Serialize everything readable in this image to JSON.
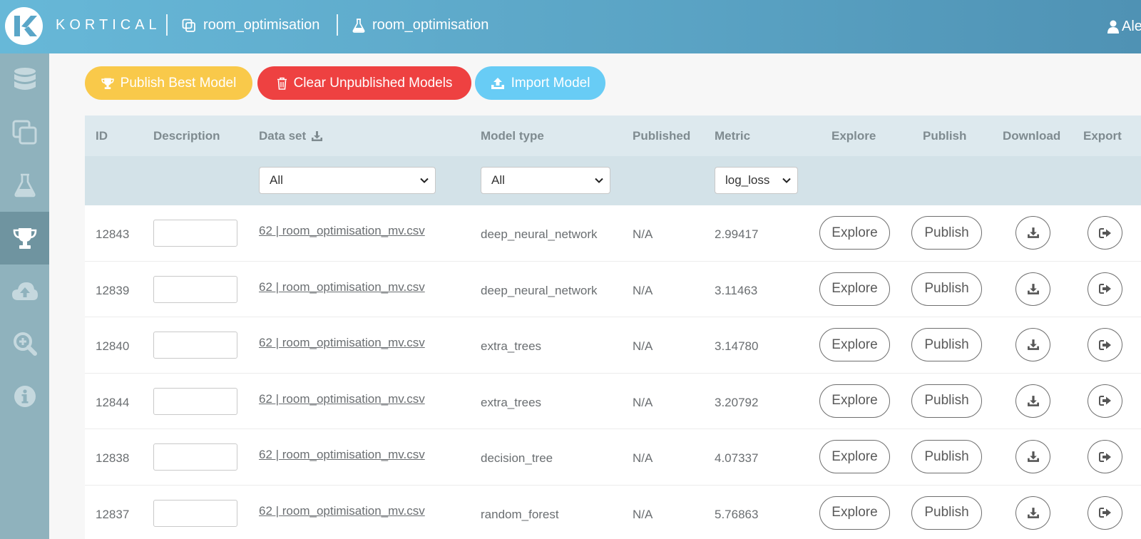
{
  "header": {
    "brand": "KORTICAL",
    "project": "room_optimisation",
    "experiment": "room_optimisation",
    "user": "Ale"
  },
  "sidebar": {
    "items": [
      {
        "name": "database-icon",
        "active": false
      },
      {
        "name": "copy-icon",
        "active": false
      },
      {
        "name": "flask-icon",
        "active": false
      },
      {
        "name": "trophy-icon",
        "active": true
      },
      {
        "name": "cloud-upload-icon",
        "active": false
      },
      {
        "name": "search-plus-icon",
        "active": false
      },
      {
        "name": "info-icon",
        "active": false
      }
    ]
  },
  "actions": {
    "publish_best": "Publish Best Model",
    "clear_unpublished": "Clear Unpublished Models",
    "import_model": "Import Model"
  },
  "colors": {
    "publish_best": "#f9c94a",
    "clear_unpublished": "#ee4141",
    "import_model": "#68ccf5"
  },
  "table": {
    "headers": {
      "id": "ID",
      "description": "Description",
      "dataset": "Data set",
      "model_type": "Model type",
      "published": "Published",
      "metric": "Metric",
      "explore": "Explore",
      "publish": "Publish",
      "download": "Download",
      "export": "Export"
    },
    "filters": {
      "dataset": "All",
      "model_type": "All",
      "metric": "log_loss"
    },
    "explore_label": "Explore",
    "publish_label": "Publish",
    "rows": [
      {
        "id": "12843",
        "description": "",
        "dataset": "62 | room_optimisation_mv.csv",
        "model_type": "deep_neural_network",
        "published": "N/A",
        "metric": "2.99417"
      },
      {
        "id": "12839",
        "description": "",
        "dataset": "62 | room_optimisation_mv.csv",
        "model_type": "deep_neural_network",
        "published": "N/A",
        "metric": "3.11463"
      },
      {
        "id": "12840",
        "description": "",
        "dataset": "62 | room_optimisation_mv.csv",
        "model_type": "extra_trees",
        "published": "N/A",
        "metric": "3.14780"
      },
      {
        "id": "12844",
        "description": "",
        "dataset": "62 | room_optimisation_mv.csv",
        "model_type": "extra_trees",
        "published": "N/A",
        "metric": "3.20792"
      },
      {
        "id": "12838",
        "description": "",
        "dataset": "62 | room_optimisation_mv.csv",
        "model_type": "decision_tree",
        "published": "N/A",
        "metric": "4.07337"
      },
      {
        "id": "12837",
        "description": "",
        "dataset": "62 | room_optimisation_mv.csv",
        "model_type": "random_forest",
        "published": "N/A",
        "metric": "5.76863"
      }
    ]
  }
}
